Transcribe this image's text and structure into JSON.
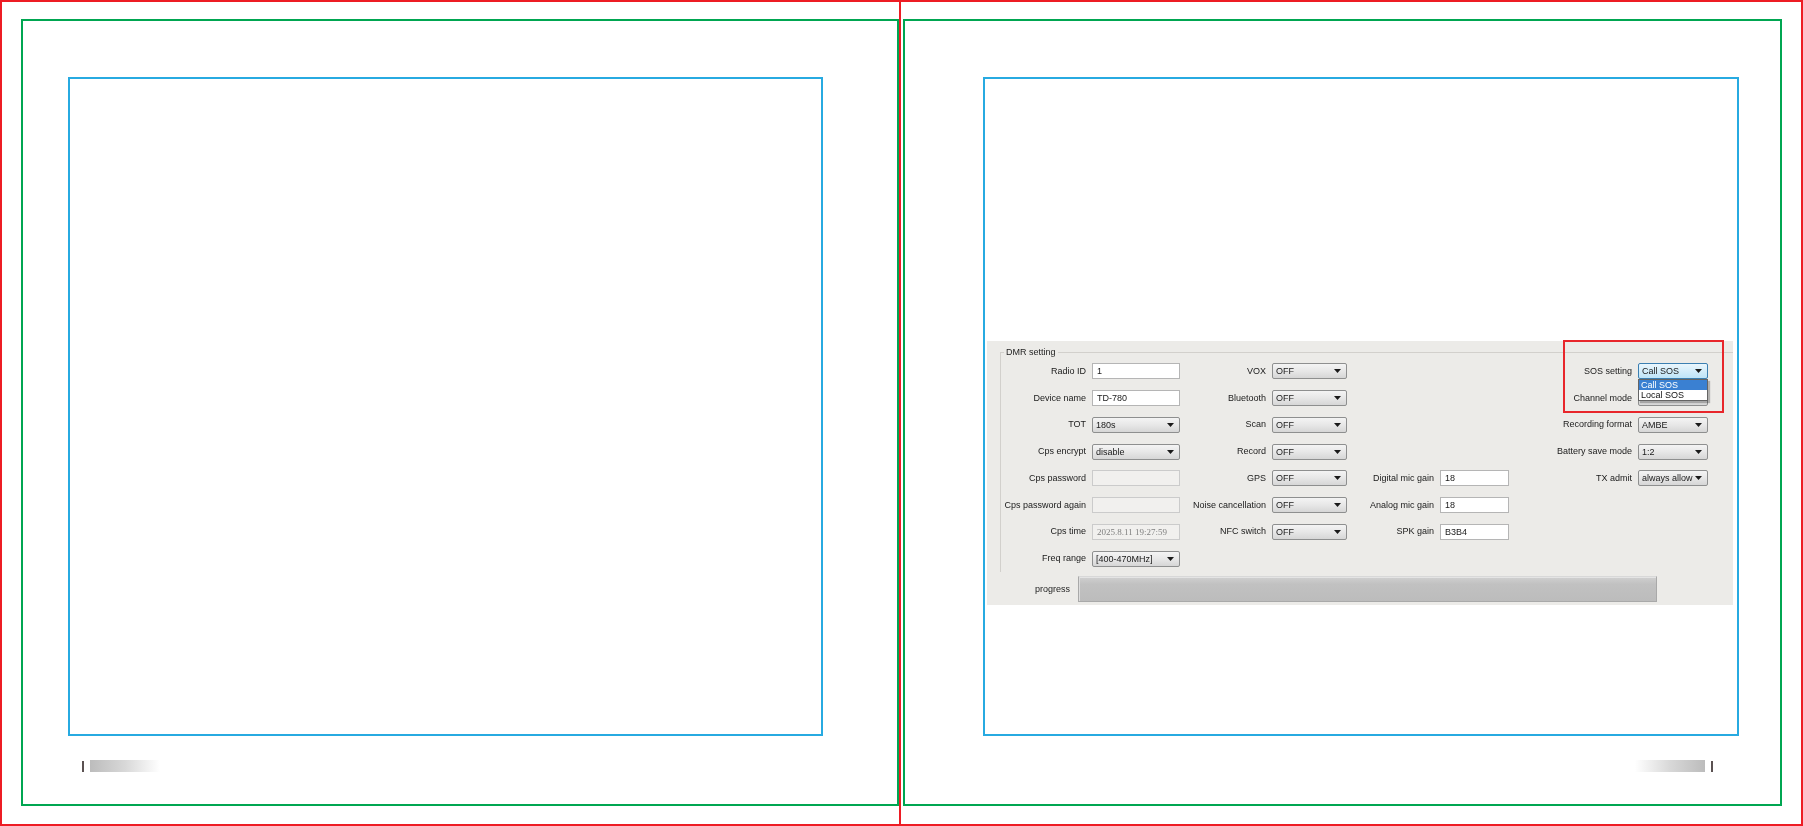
{
  "dmr_setting": {
    "title": "DMR setting",
    "rows": [
      {
        "column_1": {
          "label": "Radio ID",
          "kind": "text",
          "value": "1",
          "disabled": false,
          "highlighted": false
        },
        "column_2": {
          "label": "VOX",
          "kind": "combo",
          "value": "OFF",
          "disabled": false,
          "open": false,
          "highlighted": false
        },
        "column_4": {
          "label": "SOS setting",
          "kind": "combo",
          "value": "Call SOS",
          "disabled": false,
          "open": true,
          "highlighted": true,
          "options": [
            {
              "label": "Call SOS",
              "selected": true
            },
            {
              "label": "Local SOS",
              "selected": false
            }
          ]
        }
      },
      {
        "column_1": {
          "label": "Device name",
          "kind": "text",
          "value": "TD-780",
          "disabled": false,
          "highlighted": false
        },
        "column_2": {
          "label": "Bluetooth",
          "kind": "combo",
          "value": "OFF",
          "disabled": false,
          "open": false,
          "highlighted": false
        },
        "column_4": {
          "label": "Channel mode",
          "kind": "combo",
          "disabled": false,
          "open": false,
          "highlighted": true
        }
      },
      {
        "column_1": {
          "label": "TOT",
          "kind": "combo",
          "value": "180s",
          "disabled": false,
          "open": false,
          "highlighted": false
        },
        "column_2": {
          "label": "Scan",
          "kind": "combo",
          "value": "OFF",
          "disabled": false,
          "open": false,
          "highlighted": false
        },
        "column_4": {
          "label": "Recording format",
          "kind": "combo",
          "value": "AMBE",
          "disabled": false,
          "open": false,
          "highlighted": false
        }
      },
      {
        "column_1": {
          "label": "Cps encrypt",
          "kind": "combo",
          "value": "disable",
          "disabled": false,
          "open": false,
          "highlighted": false
        },
        "column_2": {
          "label": "Record",
          "kind": "combo",
          "value": "OFF",
          "disabled": false,
          "open": false,
          "highlighted": false
        },
        "column_4": {
          "label": "Battery save mode",
          "kind": "combo",
          "value": "1:2",
          "disabled": false,
          "open": false,
          "highlighted": false
        }
      },
      {
        "column_1": {
          "label": "Cps password",
          "kind": "text",
          "disabled": true,
          "highlighted": false
        },
        "column_2": {
          "label": "GPS",
          "kind": "combo",
          "value": "OFF",
          "disabled": false,
          "open": false,
          "highlighted": false
        },
        "column_3": {
          "label": "Digital mic gain",
          "kind": "text",
          "value": "18",
          "disabled": false,
          "highlighted": false
        },
        "column_4": {
          "label": "TX admit",
          "kind": "combo",
          "value": "always allow",
          "disabled": false,
          "open": false,
          "highlighted": false
        }
      },
      {
        "column_1": {
          "label": "Cps password again",
          "kind": "text",
          "disabled": true,
          "highlighted": false
        },
        "column_2": {
          "label": "Noise cancellation",
          "kind": "combo",
          "value": "OFF",
          "disabled": false,
          "open": false,
          "highlighted": false
        },
        "column_3": {
          "label": "Analog mic gain",
          "kind": "text",
          "value": "18",
          "disabled": false,
          "highlighted": false
        }
      },
      {
        "column_1": {
          "label": "Cps time",
          "kind": "text",
          "value": "2025.8.11 19:27:59",
          "disabled": true,
          "highlighted": false
        },
        "column_2": {
          "label": "NFC switch",
          "kind": "combo",
          "value": "OFF",
          "disabled": false,
          "open": false,
          "highlighted": false
        },
        "column_3": {
          "label": "SPK gain",
          "kind": "text",
          "value": "B3B4",
          "disabled": false,
          "highlighted": false
        }
      },
      {
        "column_1": {
          "label": "Freq range",
          "kind": "combo",
          "value": "[400-470MHz]",
          "disabled": false,
          "open": false,
          "highlighted": false
        }
      }
    ],
    "progress": {
      "label": "progress",
      "level": 0
    }
  }
}
